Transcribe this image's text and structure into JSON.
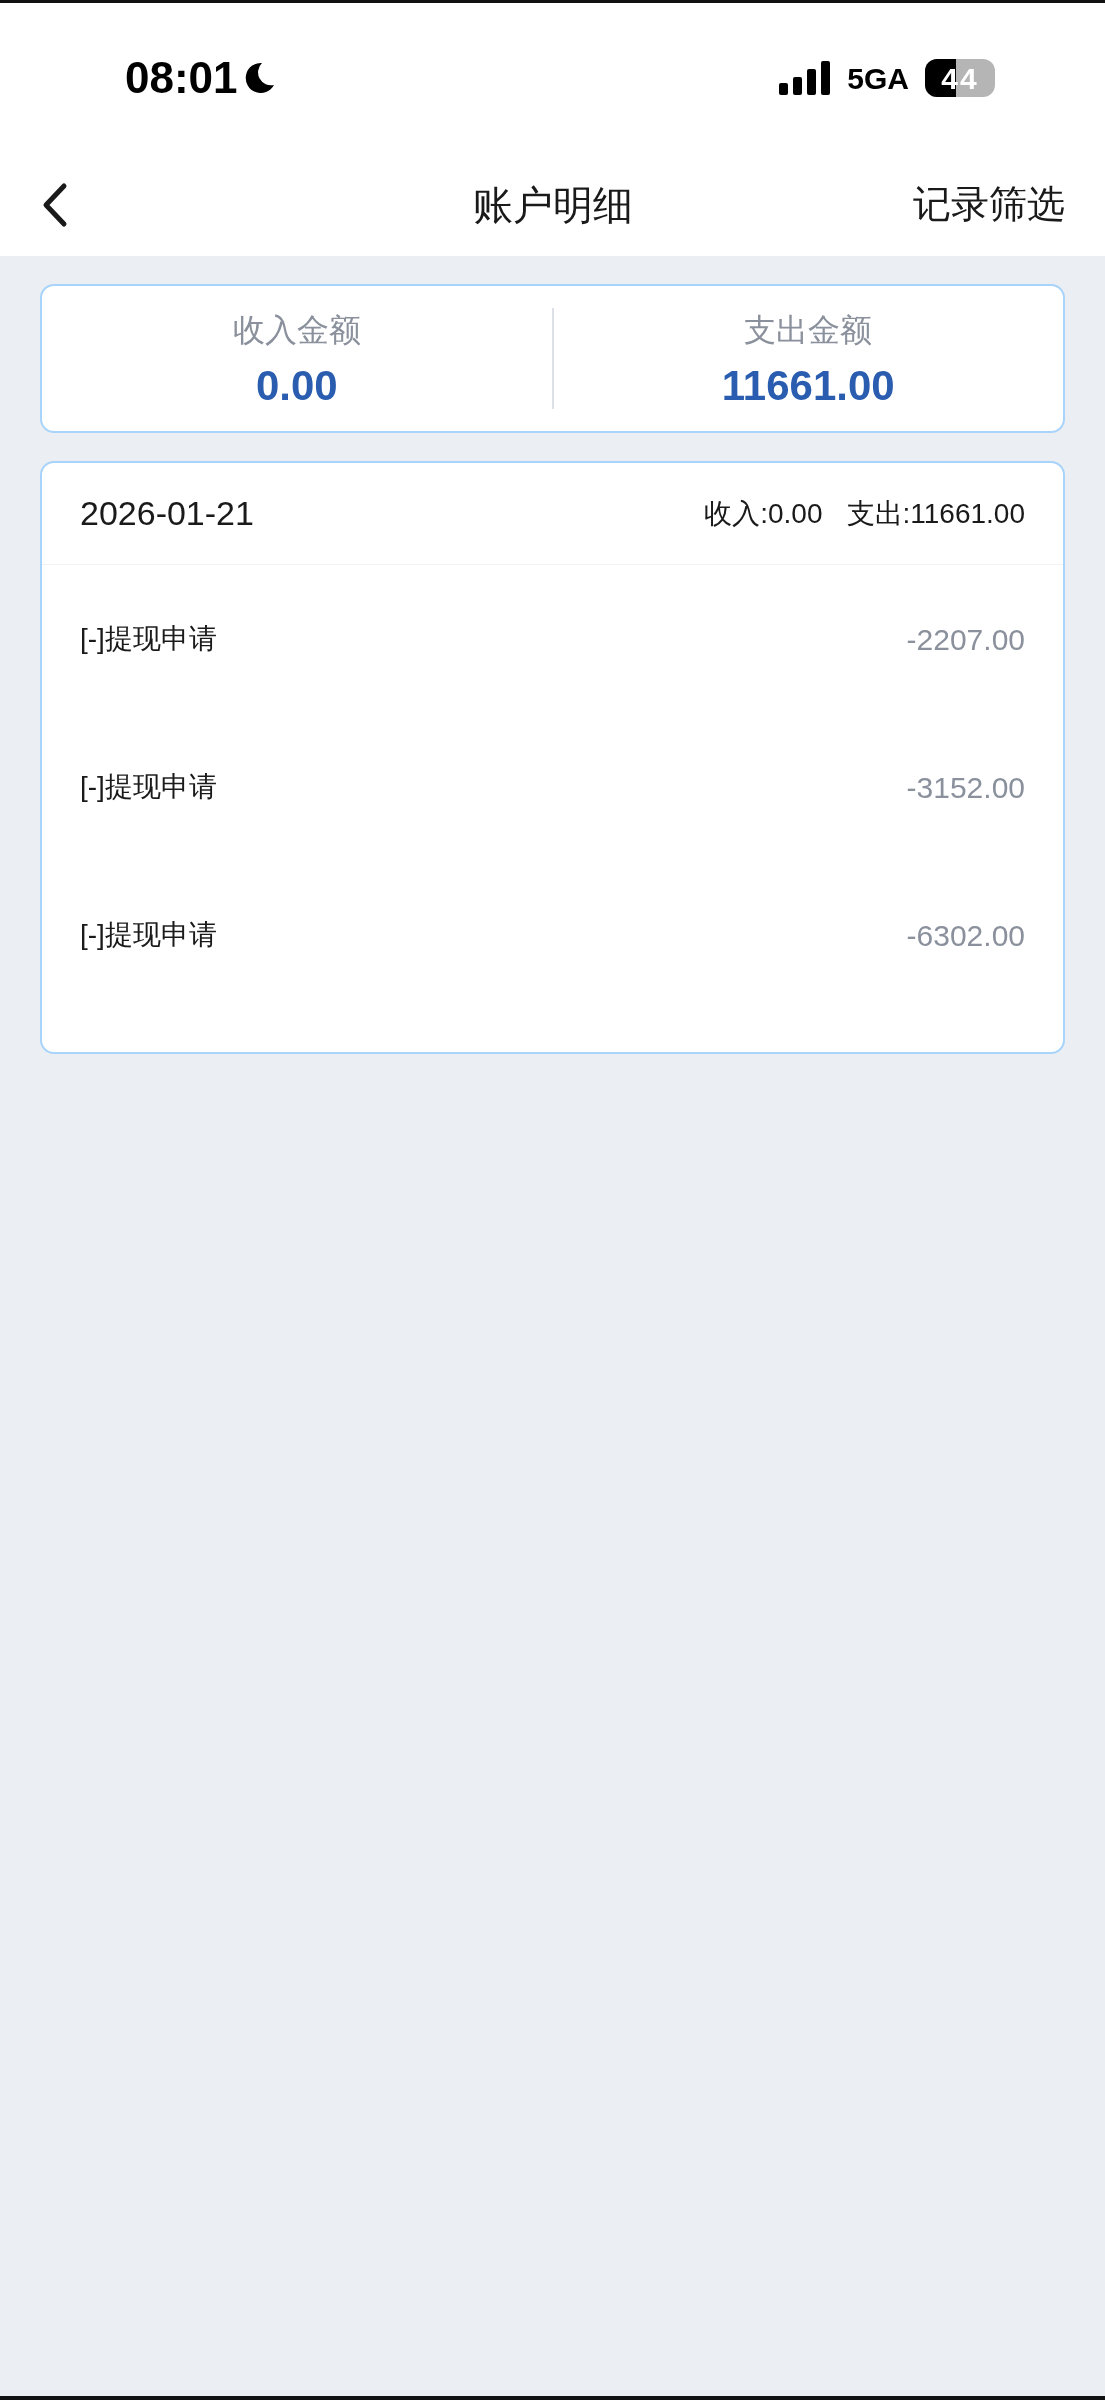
{
  "status_bar": {
    "time": "08:01",
    "network": "5GA",
    "battery": "44"
  },
  "nav": {
    "title": "账户明细",
    "action": "记录筛选"
  },
  "summary": [
    {
      "label": "收入金额",
      "amount": "0.00"
    },
    {
      "label": "支出金额",
      "amount": "11661.00"
    }
  ],
  "day": {
    "date": "2026-01-21",
    "income": "收入:0.00",
    "expense": "支出:11661.00",
    "records": [
      {
        "title": "[-]提现申请",
        "amount": "-2207.00"
      },
      {
        "title": "[-]提现申请",
        "amount": "-3152.00"
      },
      {
        "title": "[-]提现申请",
        "amount": "-6302.00"
      }
    ]
  }
}
